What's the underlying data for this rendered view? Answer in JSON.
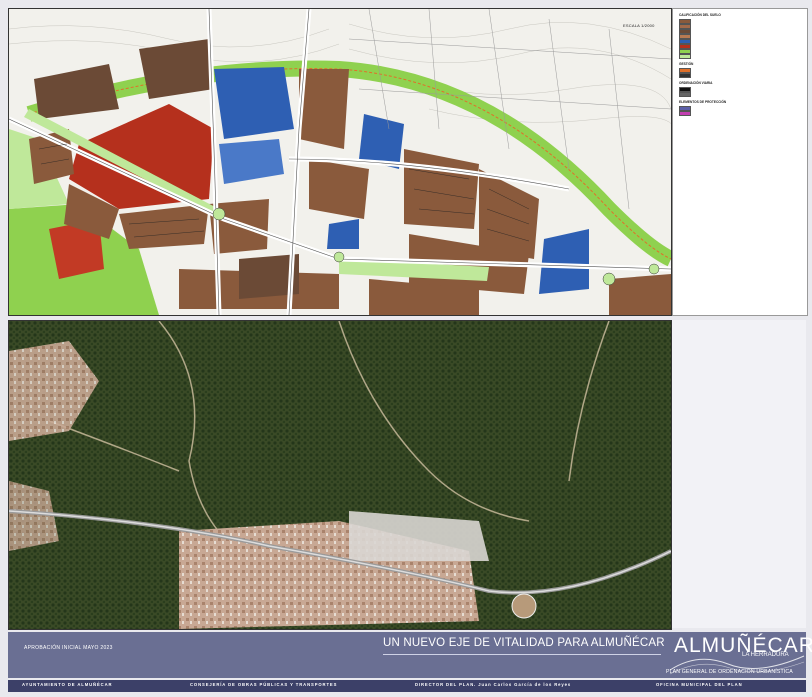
{
  "map": {
    "scale": "ESCALA 1/2000"
  },
  "legend": {
    "sections": [
      {
        "title": "Calificación del suelo",
        "items": [
          {
            "color": "#8a5a3c",
            "label": ""
          },
          {
            "color": "#a36a4a",
            "label": ""
          },
          {
            "color": "#6b4a36",
            "label": ""
          },
          {
            "color": "#b87a52",
            "label": ""
          },
          {
            "color": "#2e5fb3",
            "label": ""
          },
          {
            "color": "#b5301d",
            "label": ""
          },
          {
            "color": "#8fd14f",
            "label": ""
          },
          {
            "color": "#bfe89a",
            "label": ""
          }
        ]
      },
      {
        "title": "Gestión",
        "items": [
          {
            "color": "#e0702a",
            "label": ""
          },
          {
            "color": "#333333",
            "label": ""
          }
        ]
      },
      {
        "title": "Ordenación viaria",
        "items": [
          {
            "color": "#111111",
            "label": ""
          },
          {
            "color": "#666666",
            "label": ""
          }
        ]
      },
      {
        "title": "Elementos de protección",
        "items": [
          {
            "color": "#5b5fa8",
            "label": ""
          },
          {
            "color": "#c23fb0",
            "label": ""
          }
        ]
      }
    ]
  },
  "text": {
    "paragraphs": [
      "",
      "",
      ""
    ]
  },
  "footer": {
    "approval": "APROBACIÓN INICIAL   MAYO 2023",
    "title": "UN NUEVO EJE DE VITALIDAD PARA ALMUÑÉCAR",
    "brand": "ALMUÑÉCAR",
    "brand_sub": "LA HERRADURA",
    "plan_name": "PLAN GENERAL DE ORDENACIÓN URBANÍSTICA"
  },
  "credits": {
    "ayuntamiento": "AYUNTAMIENTO DE ALMUÑÉCAR",
    "consejeria": "CONSEJERÍA DE OBRAS PÚBLICAS Y TRANSPORTES",
    "director": "DIRECTOR DEL PLAN. Juan Carlos García de los Reyes",
    "oficina": "OFICINA MUNICIPAL DEL PLAN"
  },
  "colors": {
    "footer_band": "#6a6f93",
    "credits_band": "#3c4068",
    "residential": "#8a5a3c",
    "equipment": "#2e5fb3",
    "industrial": "#b5301d",
    "green": "#8fd14f"
  }
}
